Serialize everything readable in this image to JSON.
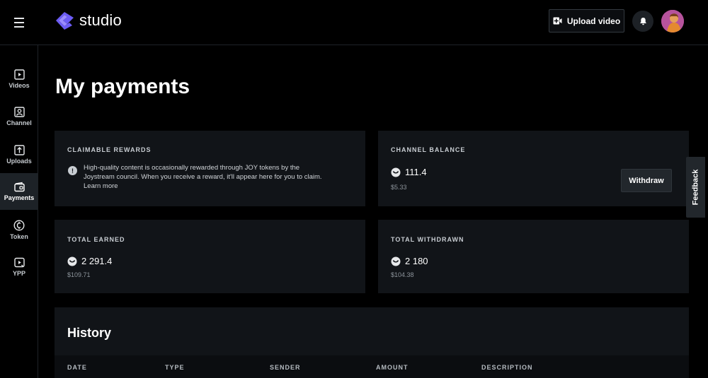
{
  "header": {
    "logo_text": "studio",
    "upload_label": "Upload video"
  },
  "sidebar": {
    "items": [
      {
        "label": "Videos",
        "icon": "video-icon"
      },
      {
        "label": "Channel",
        "icon": "channel-icon"
      },
      {
        "label": "Uploads",
        "icon": "upload-icon"
      },
      {
        "label": "Payments",
        "icon": "wallet-icon",
        "active": true
      },
      {
        "label": "Token",
        "icon": "token-icon"
      },
      {
        "label": "YPP",
        "icon": "ypp-icon"
      }
    ]
  },
  "page": {
    "title": "My payments"
  },
  "cards": {
    "claimable": {
      "title": "CLAIMABLE REWARDS",
      "text": "High-quality content is occasionally rewarded through JOY tokens by the Joystream council. When you receive a reward, it'll appear here for you to claim.",
      "link": "Learn more"
    },
    "balance": {
      "title": "CHANNEL BALANCE",
      "amount": "111.4",
      "usd": "$5.33",
      "button": "Withdraw"
    },
    "earned": {
      "title": "TOTAL EARNED",
      "amount": "2 291.4",
      "usd": "$109.71"
    },
    "withdrawn": {
      "title": "TOTAL WITHDRAWN",
      "amount": "2 180",
      "usd": "$104.38"
    }
  },
  "history": {
    "title": "History",
    "columns": [
      "DATE",
      "TYPE",
      "SENDER",
      "AMOUNT",
      "DESCRIPTION"
    ]
  },
  "feedback_label": "Feedback",
  "colors": {
    "background": "#000000",
    "card": "#111418",
    "logo_accent": "#6c5cf6",
    "active_nav": "#1d2227"
  }
}
